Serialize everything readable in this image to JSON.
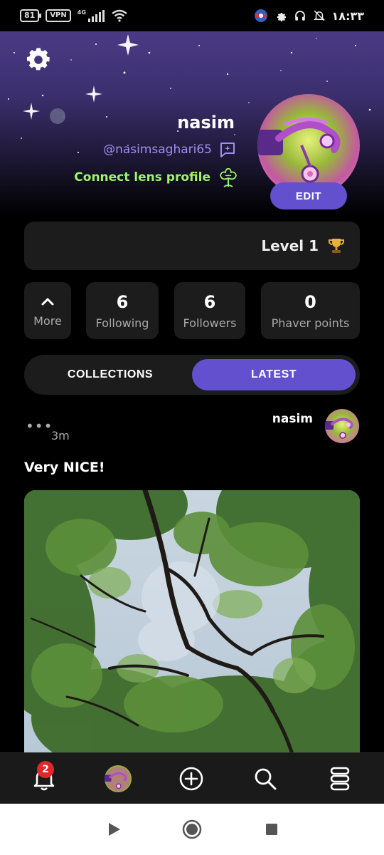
{
  "status_bar": {
    "battery": "81",
    "vpn": "VPN",
    "network": "4G",
    "time": "۱۸:۳۳"
  },
  "profile": {
    "username": "nasim",
    "handle": "@nasimsaghari65",
    "lens_link": "Connect lens profile",
    "edit_label": "EDIT",
    "level": "Level 1"
  },
  "stats": {
    "more_label": "More",
    "following": {
      "value": "6",
      "label": "Following"
    },
    "followers": {
      "value": "6",
      "label": "Followers"
    },
    "points": {
      "value": "0",
      "label": "Phaver points"
    }
  },
  "tabs": [
    {
      "label": "COLLECTIONS",
      "active": false
    },
    {
      "label": "LATEST",
      "active": true
    }
  ],
  "post": {
    "menu": "•••",
    "time": "3m",
    "author": "nasim",
    "text": "Very NICE!"
  },
  "bottom_nav": {
    "notification_count": "2",
    "items": [
      "bell-icon",
      "profile-avatar",
      "add-icon",
      "search-icon",
      "feed-stack-icon"
    ]
  },
  "colors": {
    "accent": "#6250cf",
    "lens_green": "#9ef566",
    "handle_purple": "#a08ff0",
    "card_bg": "#1c1c1c",
    "badge_red": "#e3262a"
  }
}
